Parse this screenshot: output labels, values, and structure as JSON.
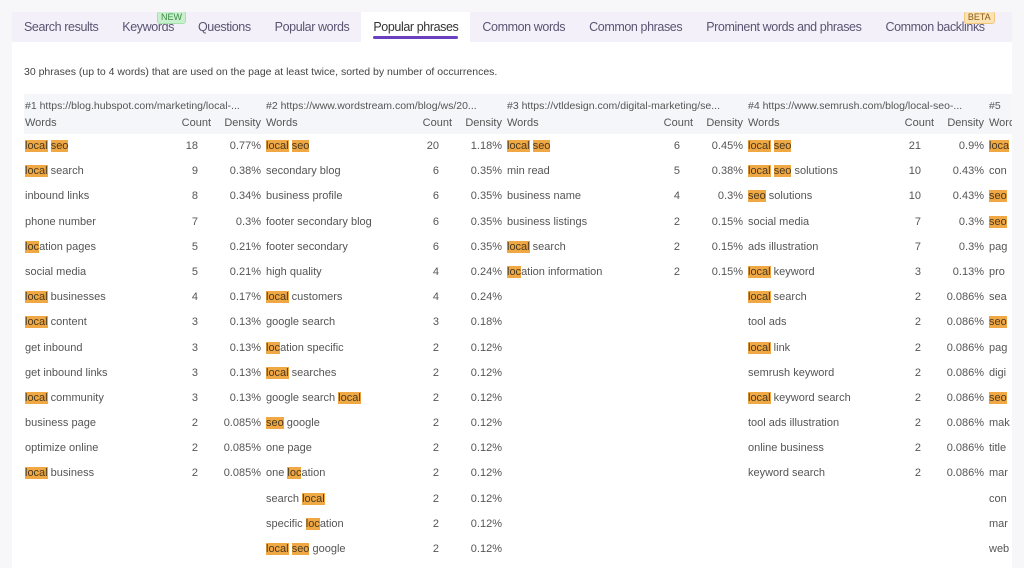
{
  "tabs": [
    {
      "label": "Search results",
      "active": false
    },
    {
      "label": "Keywords",
      "active": false,
      "badge": "NEW"
    },
    {
      "label": "Questions",
      "active": false
    },
    {
      "label": "Popular words",
      "active": false
    },
    {
      "label": "Popular phrases",
      "active": true
    },
    {
      "label": "Common words",
      "active": false
    },
    {
      "label": "Common phrases",
      "active": false
    },
    {
      "label": "Prominent words and phrases",
      "active": false
    },
    {
      "label": "Common backlinks",
      "active": false,
      "badge": "BETA"
    }
  ],
  "description": "30 phrases (up to 4 words) that are used on the page at least twice, sorted by number of occurrences.",
  "column_labels": {
    "words": "Words",
    "count": "Count",
    "density": "Density"
  },
  "highlight_color": "#f0a844",
  "accent_color": "#6a40c0",
  "columns": [
    {
      "url": "#1 https://blog.hubspot.com/marketing/local-...",
      "rows": [
        {
          "phrase": [
            [
              "local",
              true
            ],
            [
              " ",
              false
            ],
            [
              "seo",
              true
            ]
          ],
          "count": "18",
          "density": "0.77%"
        },
        {
          "phrase": [
            [
              "local",
              true
            ],
            [
              " search",
              false
            ]
          ],
          "count": "9",
          "density": "0.38%"
        },
        {
          "phrase": [
            [
              "inbound links",
              false
            ]
          ],
          "count": "8",
          "density": "0.34%"
        },
        {
          "phrase": [
            [
              "phone number",
              false
            ]
          ],
          "count": "7",
          "density": "0.3%"
        },
        {
          "phrase": [
            [
              "loc",
              true
            ],
            [
              "ation pages",
              false
            ]
          ],
          "count": "5",
          "density": "0.21%"
        },
        {
          "phrase": [
            [
              "social media",
              false
            ]
          ],
          "count": "5",
          "density": "0.21%"
        },
        {
          "phrase": [
            [
              "local",
              true
            ],
            [
              " businesses",
              false
            ]
          ],
          "count": "4",
          "density": "0.17%"
        },
        {
          "phrase": [
            [
              "local",
              true
            ],
            [
              " content",
              false
            ]
          ],
          "count": "3",
          "density": "0.13%"
        },
        {
          "phrase": [
            [
              "get inbound",
              false
            ]
          ],
          "count": "3",
          "density": "0.13%"
        },
        {
          "phrase": [
            [
              "get inbound links",
              false
            ]
          ],
          "count": "3",
          "density": "0.13%"
        },
        {
          "phrase": [
            [
              "local",
              true
            ],
            [
              " community",
              false
            ]
          ],
          "count": "3",
          "density": "0.13%"
        },
        {
          "phrase": [
            [
              "business page",
              false
            ]
          ],
          "count": "2",
          "density": "0.085%"
        },
        {
          "phrase": [
            [
              "optimize online",
              false
            ]
          ],
          "count": "2",
          "density": "0.085%"
        },
        {
          "phrase": [
            [
              "local",
              true
            ],
            [
              " business",
              false
            ]
          ],
          "count": "2",
          "density": "0.085%"
        }
      ]
    },
    {
      "url": "#2 https://www.wordstream.com/blog/ws/20...",
      "rows": [
        {
          "phrase": [
            [
              "local",
              true
            ],
            [
              " ",
              false
            ],
            [
              "seo",
              true
            ]
          ],
          "count": "20",
          "density": "1.18%"
        },
        {
          "phrase": [
            [
              "secondary blog",
              false
            ]
          ],
          "count": "6",
          "density": "0.35%"
        },
        {
          "phrase": [
            [
              "business profile",
              false
            ]
          ],
          "count": "6",
          "density": "0.35%"
        },
        {
          "phrase": [
            [
              "footer secondary blog",
              false
            ]
          ],
          "count": "6",
          "density": "0.35%"
        },
        {
          "phrase": [
            [
              "footer secondary",
              false
            ]
          ],
          "count": "6",
          "density": "0.35%"
        },
        {
          "phrase": [
            [
              "high quality",
              false
            ]
          ],
          "count": "4",
          "density": "0.24%"
        },
        {
          "phrase": [
            [
              "local",
              true
            ],
            [
              " customers",
              false
            ]
          ],
          "count": "4",
          "density": "0.24%"
        },
        {
          "phrase": [
            [
              "google search",
              false
            ]
          ],
          "count": "3",
          "density": "0.18%"
        },
        {
          "phrase": [
            [
              "loc",
              true
            ],
            [
              "ation specific",
              false
            ]
          ],
          "count": "2",
          "density": "0.12%"
        },
        {
          "phrase": [
            [
              "local",
              true
            ],
            [
              " searches",
              false
            ]
          ],
          "count": "2",
          "density": "0.12%"
        },
        {
          "phrase": [
            [
              "google search ",
              false
            ],
            [
              "local",
              true
            ]
          ],
          "count": "2",
          "density": "0.12%"
        },
        {
          "phrase": [
            [
              "seo",
              true
            ],
            [
              " google",
              false
            ]
          ],
          "count": "2",
          "density": "0.12%"
        },
        {
          "phrase": [
            [
              "one page",
              false
            ]
          ],
          "count": "2",
          "density": "0.12%"
        },
        {
          "phrase": [
            [
              "one ",
              false
            ],
            [
              "loc",
              true
            ],
            [
              "ation",
              false
            ]
          ],
          "count": "2",
          "density": "0.12%"
        },
        {
          "phrase": [
            [
              "search ",
              false
            ],
            [
              "local",
              true
            ]
          ],
          "count": "2",
          "density": "0.12%"
        },
        {
          "phrase": [
            [
              "specific ",
              false
            ],
            [
              "loc",
              true
            ],
            [
              "ation",
              false
            ]
          ],
          "count": "2",
          "density": "0.12%"
        },
        {
          "phrase": [
            [
              "local",
              true
            ],
            [
              " ",
              false
            ],
            [
              "seo",
              true
            ],
            [
              " google",
              false
            ]
          ],
          "count": "2",
          "density": "0.12%"
        }
      ]
    },
    {
      "url": "#3 https://vtldesign.com/digital-marketing/se...",
      "rows": [
        {
          "phrase": [
            [
              "local",
              true
            ],
            [
              " ",
              false
            ],
            [
              "seo",
              true
            ]
          ],
          "count": "6",
          "density": "0.45%"
        },
        {
          "phrase": [
            [
              "min read",
              false
            ]
          ],
          "count": "5",
          "density": "0.38%"
        },
        {
          "phrase": [
            [
              "business name",
              false
            ]
          ],
          "count": "4",
          "density": "0.3%"
        },
        {
          "phrase": [
            [
              "business listings",
              false
            ]
          ],
          "count": "2",
          "density": "0.15%"
        },
        {
          "phrase": [
            [
              "local",
              true
            ],
            [
              " search",
              false
            ]
          ],
          "count": "2",
          "density": "0.15%"
        },
        {
          "phrase": [
            [
              "loc",
              true
            ],
            [
              "ation information",
              false
            ]
          ],
          "count": "2",
          "density": "0.15%"
        }
      ]
    },
    {
      "url": "#4 https://www.semrush.com/blog/local-seo-...",
      "rows": [
        {
          "phrase": [
            [
              "local",
              true
            ],
            [
              " ",
              false
            ],
            [
              "seo",
              true
            ]
          ],
          "count": "21",
          "density": "0.9%"
        },
        {
          "phrase": [
            [
              "local",
              true
            ],
            [
              " ",
              false
            ],
            [
              "seo",
              true
            ],
            [
              " solutions",
              false
            ]
          ],
          "count": "10",
          "density": "0.43%"
        },
        {
          "phrase": [
            [
              "seo",
              true
            ],
            [
              " solutions",
              false
            ]
          ],
          "count": "10",
          "density": "0.43%"
        },
        {
          "phrase": [
            [
              "social media",
              false
            ]
          ],
          "count": "7",
          "density": "0.3%"
        },
        {
          "phrase": [
            [
              "ads illustration",
              false
            ]
          ],
          "count": "7",
          "density": "0.3%"
        },
        {
          "phrase": [
            [
              "local",
              true
            ],
            [
              " keyword",
              false
            ]
          ],
          "count": "3",
          "density": "0.13%"
        },
        {
          "phrase": [
            [
              "local",
              true
            ],
            [
              " search",
              false
            ]
          ],
          "count": "2",
          "density": "0.086%"
        },
        {
          "phrase": [
            [
              "tool ads",
              false
            ]
          ],
          "count": "2",
          "density": "0.086%"
        },
        {
          "phrase": [
            [
              "local",
              true
            ],
            [
              " link",
              false
            ]
          ],
          "count": "2",
          "density": "0.086%"
        },
        {
          "phrase": [
            [
              "semrush keyword",
              false
            ]
          ],
          "count": "2",
          "density": "0.086%"
        },
        {
          "phrase": [
            [
              "local",
              true
            ],
            [
              " keyword search",
              false
            ]
          ],
          "count": "2",
          "density": "0.086%"
        },
        {
          "phrase": [
            [
              "tool ads illustration",
              false
            ]
          ],
          "count": "2",
          "density": "0.086%"
        },
        {
          "phrase": [
            [
              "online business",
              false
            ]
          ],
          "count": "2",
          "density": "0.086%"
        },
        {
          "phrase": [
            [
              "keyword search",
              false
            ]
          ],
          "count": "2",
          "density": "0.086%"
        }
      ]
    },
    {
      "url": "#5",
      "partial": true,
      "rows": [
        {
          "phrase": [
            [
              "loca",
              true
            ]
          ],
          "count": "",
          "density": ""
        },
        {
          "phrase": [
            [
              "con",
              false
            ]
          ],
          "count": "",
          "density": ""
        },
        {
          "phrase": [
            [
              "seo",
              true
            ]
          ],
          "count": "",
          "density": ""
        },
        {
          "phrase": [
            [
              "seo",
              true
            ]
          ],
          "count": "",
          "density": ""
        },
        {
          "phrase": [
            [
              "pag",
              false
            ]
          ],
          "count": "",
          "density": ""
        },
        {
          "phrase": [
            [
              "pro",
              false
            ]
          ],
          "count": "",
          "density": ""
        },
        {
          "phrase": [
            [
              "sea",
              false
            ]
          ],
          "count": "",
          "density": ""
        },
        {
          "phrase": [
            [
              "seo",
              true
            ]
          ],
          "count": "",
          "density": ""
        },
        {
          "phrase": [
            [
              "pag",
              false
            ]
          ],
          "count": "",
          "density": ""
        },
        {
          "phrase": [
            [
              "digi",
              false
            ]
          ],
          "count": "",
          "density": ""
        },
        {
          "phrase": [
            [
              "seo",
              true
            ]
          ],
          "count": "",
          "density": ""
        },
        {
          "phrase": [
            [
              "mak",
              false
            ]
          ],
          "count": "",
          "density": ""
        },
        {
          "phrase": [
            [
              "title",
              false
            ]
          ],
          "count": "",
          "density": ""
        },
        {
          "phrase": [
            [
              "mar",
              false
            ]
          ],
          "count": "",
          "density": ""
        },
        {
          "phrase": [
            [
              "con",
              false
            ]
          ],
          "count": "",
          "density": ""
        },
        {
          "phrase": [
            [
              "mar",
              false
            ]
          ],
          "count": "",
          "density": ""
        },
        {
          "phrase": [
            [
              "web",
              false
            ]
          ],
          "count": "",
          "density": ""
        }
      ]
    }
  ]
}
